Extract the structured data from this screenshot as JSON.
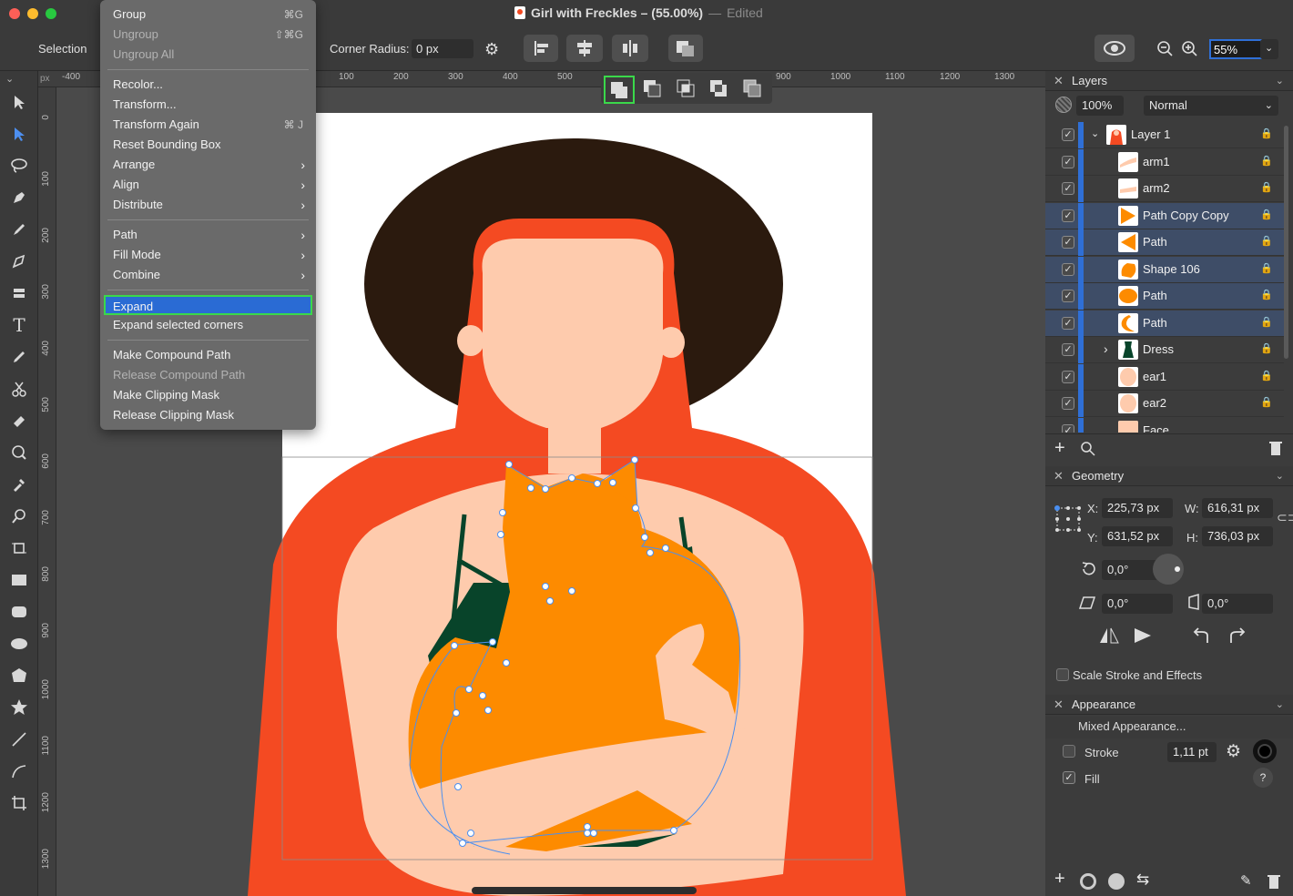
{
  "window": {
    "title": "Girl with Freckles – (55.00%)",
    "edited": "Edited"
  },
  "toolbar": {
    "tool_label": "Selection",
    "corner_radius_label": "Corner Radius:",
    "corner_radius_value": "0 px",
    "zoom_value": "55%"
  },
  "rulers": {
    "unit": "px",
    "horizontal": [
      "-400",
      "100",
      "200",
      "300",
      "400",
      "500",
      "900",
      "1000",
      "1100",
      "1200",
      "1300"
    ],
    "vertical": [
      "0",
      "100",
      "200",
      "300",
      "400",
      "500",
      "600",
      "700",
      "800",
      "900",
      "1000",
      "1100",
      "1200",
      "1300"
    ]
  },
  "context_menu": {
    "items": [
      {
        "label": "Group",
        "shortcut": "⌘G",
        "enabled": true
      },
      {
        "label": "Ungroup",
        "shortcut": "⇧⌘G",
        "enabled": false
      },
      {
        "label": "Ungroup All",
        "shortcut": "",
        "enabled": false
      },
      {
        "separator": true
      },
      {
        "label": "Recolor...",
        "enabled": true
      },
      {
        "label": "Transform...",
        "enabled": true
      },
      {
        "label": "Transform Again",
        "shortcut": "⌘ J",
        "enabled": true
      },
      {
        "label": "Reset Bounding Box",
        "enabled": true
      },
      {
        "label": "Arrange",
        "submenu": true,
        "enabled": true
      },
      {
        "label": "Align",
        "submenu": true,
        "enabled": true
      },
      {
        "label": "Distribute",
        "submenu": true,
        "enabled": true
      },
      {
        "separator": true
      },
      {
        "label": "Path",
        "submenu": true,
        "enabled": true
      },
      {
        "label": "Fill Mode",
        "submenu": true,
        "enabled": true
      },
      {
        "label": "Combine",
        "submenu": true,
        "enabled": true
      },
      {
        "separator": true
      },
      {
        "label": "Expand",
        "enabled": true,
        "highlighted": true
      },
      {
        "label": "Expand selected corners",
        "enabled": true
      },
      {
        "separator": true
      },
      {
        "label": "Make Compound Path",
        "enabled": true
      },
      {
        "label": "Release Compound Path",
        "enabled": false
      },
      {
        "label": "Make Clipping Mask",
        "enabled": true
      },
      {
        "label": "Release Clipping Mask",
        "enabled": true
      }
    ]
  },
  "layers_panel": {
    "title": "Layers",
    "opacity": "100%",
    "blend_mode": "Normal",
    "rows": [
      {
        "name": "Layer 1",
        "selected": false,
        "group": true,
        "thumb": "girl"
      },
      {
        "name": "arm1",
        "selected": false,
        "thumb": "arm"
      },
      {
        "name": "arm2",
        "selected": false,
        "thumb": "arm"
      },
      {
        "name": "Path Copy Copy",
        "selected": true,
        "thumb": "tri-right"
      },
      {
        "name": "Path",
        "selected": true,
        "thumb": "tri-left"
      },
      {
        "name": "Shape 106",
        "selected": true,
        "thumb": "blob"
      },
      {
        "name": "Path",
        "selected": true,
        "thumb": "ellipse"
      },
      {
        "name": "Path",
        "selected": true,
        "thumb": "crescent"
      },
      {
        "name": "Dress",
        "selected": false,
        "expandable": true,
        "thumb": "dress"
      },
      {
        "name": "ear1",
        "selected": false,
        "thumb": "skin"
      },
      {
        "name": "ear2",
        "selected": false,
        "thumb": "skin"
      },
      {
        "name": "Face",
        "selected": false,
        "thumb": "skin"
      }
    ]
  },
  "geometry_panel": {
    "title": "Geometry",
    "x_label": "X:",
    "x": "225,73 px",
    "y_label": "Y:",
    "y": "631,52 px",
    "w_label": "W:",
    "w": "616,31 px",
    "h_label": "H:",
    "h": "736,03 px",
    "rotation": "0,0°",
    "shear": "0,0°",
    "skew": "0,0°",
    "scale_stroke_label": "Scale Stroke and Effects"
  },
  "appearance_panel": {
    "title": "Appearance",
    "mixed": "Mixed Appearance...",
    "stroke_label": "Stroke",
    "stroke_width": "1,11 pt",
    "fill_label": "Fill",
    "help": "?"
  },
  "colors": {
    "hair": "#f44a22",
    "hat": "#2b1a0e",
    "skin": "#fecbad",
    "cat": "#fd8b00",
    "dress": "#08442a",
    "selection": "#2f6fd6",
    "highlight_border": "#3ad84a"
  }
}
